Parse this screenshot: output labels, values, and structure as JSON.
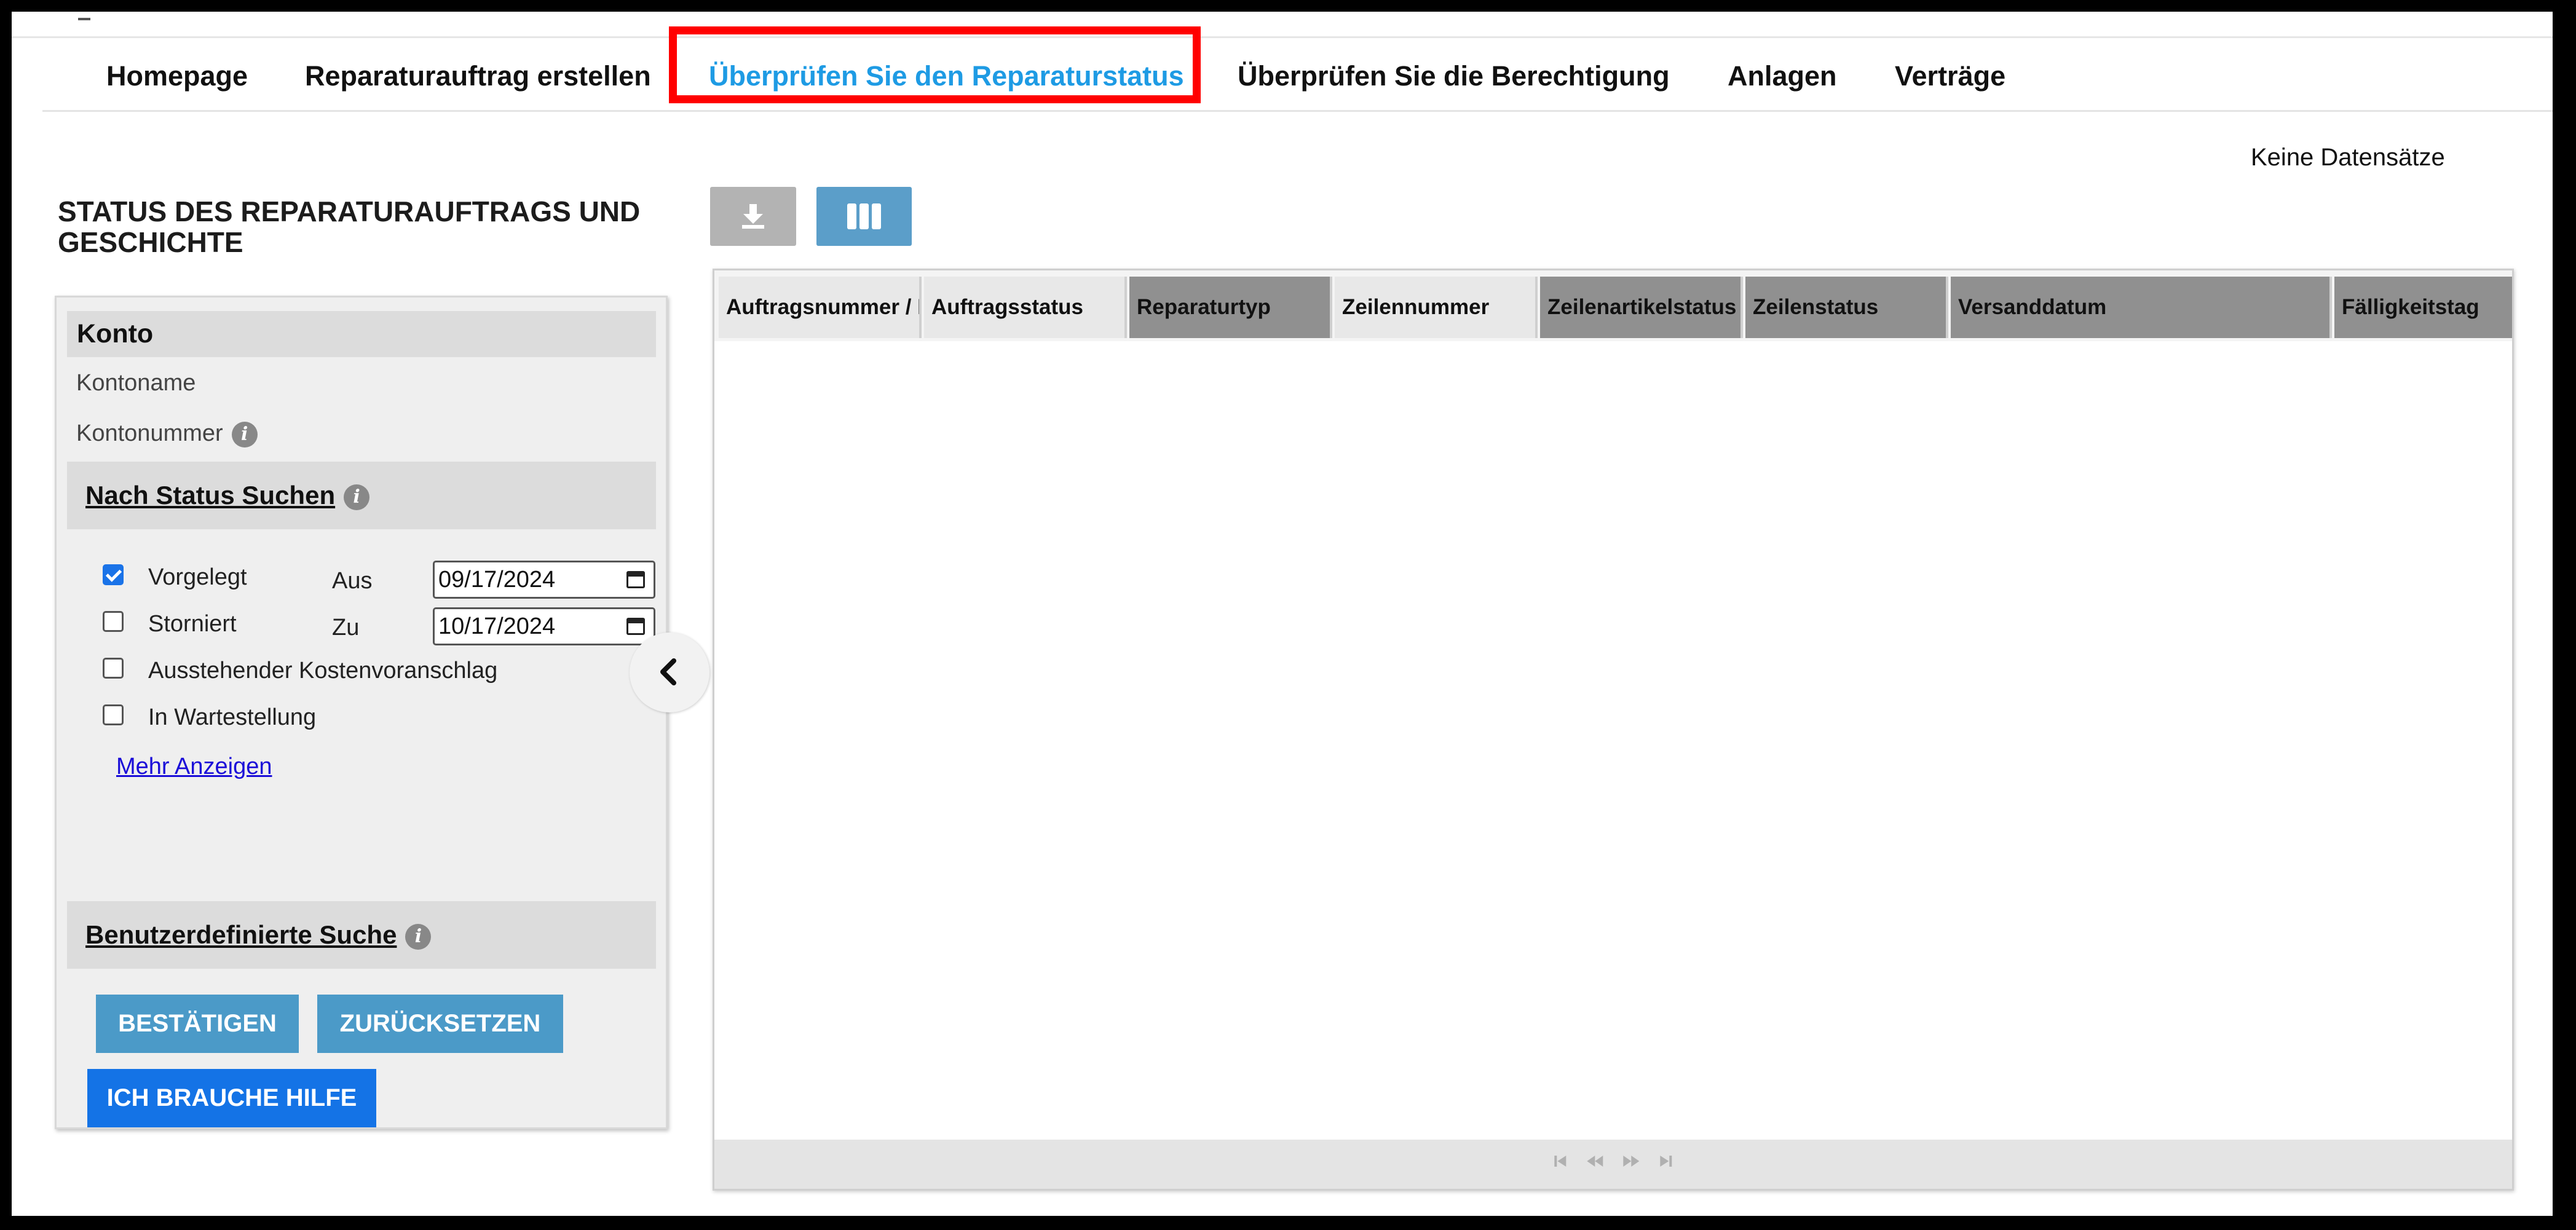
{
  "nav": {
    "items": [
      {
        "label": "Homepage",
        "active": false
      },
      {
        "label": "Reparaturauftrag erstellen",
        "active": false
      },
      {
        "label": "Überprüfen Sie den Reparaturstatus",
        "active": true
      },
      {
        "label": "Überprüfen Sie die Berechtigung",
        "active": false
      },
      {
        "label": "Anlagen",
        "active": false
      },
      {
        "label": "Verträge",
        "active": false
      }
    ]
  },
  "page": {
    "title": "STATUS DES REPARATURAUFTRAGS UND GESCHICHTE",
    "record_count": "Keine Datensätze"
  },
  "panel": {
    "account": {
      "heading": "Konto",
      "name_label": "Kontoname",
      "number_label": "Kontonummer"
    },
    "status_search": {
      "heading": "Nach Status Suchen",
      "options": [
        {
          "label": "Vorgelegt",
          "checked": true
        },
        {
          "label": "Storniert",
          "checked": false
        },
        {
          "label": "Ausstehender Kostenvoranschlag",
          "checked": false
        },
        {
          "label": "In Wartestellung",
          "checked": false
        }
      ],
      "from_label": "Aus",
      "from_value": "09/17/2024",
      "to_label": "Zu",
      "to_value": "10/17/2024",
      "more_link": "Mehr Anzeigen"
    },
    "custom_search": {
      "heading": "Benutzerdefinierte Suche"
    },
    "buttons": {
      "confirm": "BESTÄTIGEN",
      "reset": "ZURÜCKSETZEN",
      "help": "ICH BRAUCHE HILFE"
    }
  },
  "grid": {
    "columns": [
      "Auftragsnummer / I",
      "Auftragsstatus",
      "Reparaturtyp",
      "Zeilennummer",
      "Zeilenartikelstatus",
      "Zeilenstatus",
      "Versanddatum",
      "Fälligkeitstag"
    ],
    "rows": []
  },
  "colors": {
    "accent_blue": "#1e9be4",
    "button_blue": "#4b9ac8",
    "help_blue": "#1473e6",
    "highlight_red": "#ff0000"
  },
  "icons": {
    "download": "download-icon",
    "columns": "columns-icon",
    "info": "info-icon",
    "collapse": "chevron-left-icon",
    "calendar": "calendar-icon"
  }
}
